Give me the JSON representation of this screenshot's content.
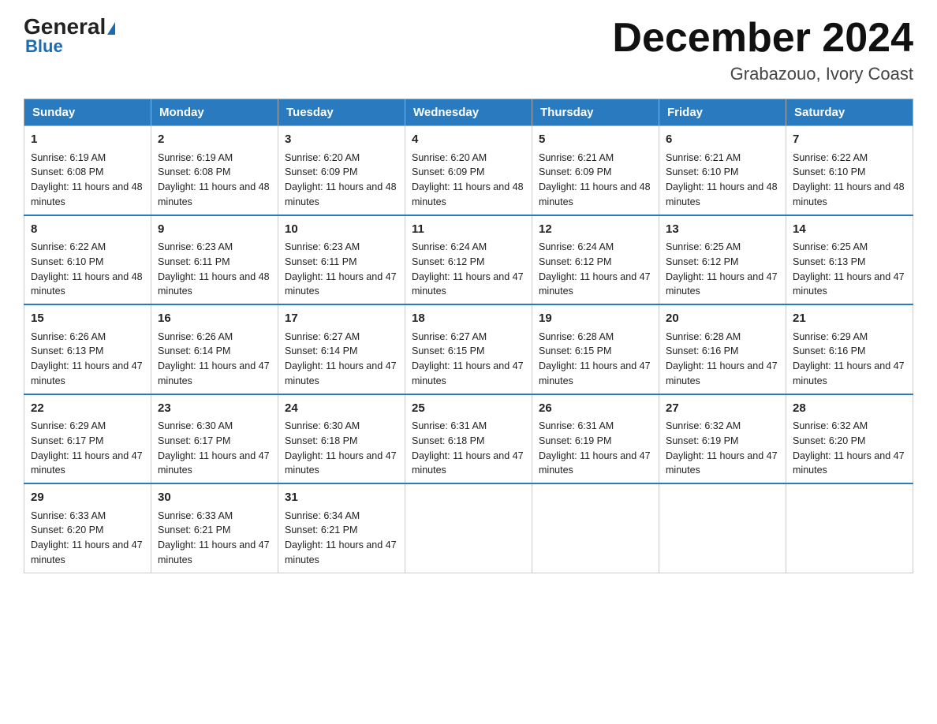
{
  "logo": {
    "brand": "General",
    "sub": "Blue"
  },
  "title": "December 2024",
  "subtitle": "Grabazouo, Ivory Coast",
  "days": [
    "Sunday",
    "Monday",
    "Tuesday",
    "Wednesday",
    "Thursday",
    "Friday",
    "Saturday"
  ],
  "weeks": [
    [
      {
        "num": "1",
        "sunrise": "6:19 AM",
        "sunset": "6:08 PM",
        "daylight": "11 hours and 48 minutes."
      },
      {
        "num": "2",
        "sunrise": "6:19 AM",
        "sunset": "6:08 PM",
        "daylight": "11 hours and 48 minutes."
      },
      {
        "num": "3",
        "sunrise": "6:20 AM",
        "sunset": "6:09 PM",
        "daylight": "11 hours and 48 minutes."
      },
      {
        "num": "4",
        "sunrise": "6:20 AM",
        "sunset": "6:09 PM",
        "daylight": "11 hours and 48 minutes."
      },
      {
        "num": "5",
        "sunrise": "6:21 AM",
        "sunset": "6:09 PM",
        "daylight": "11 hours and 48 minutes."
      },
      {
        "num": "6",
        "sunrise": "6:21 AM",
        "sunset": "6:10 PM",
        "daylight": "11 hours and 48 minutes."
      },
      {
        "num": "7",
        "sunrise": "6:22 AM",
        "sunset": "6:10 PM",
        "daylight": "11 hours and 48 minutes."
      }
    ],
    [
      {
        "num": "8",
        "sunrise": "6:22 AM",
        "sunset": "6:10 PM",
        "daylight": "11 hours and 48 minutes."
      },
      {
        "num": "9",
        "sunrise": "6:23 AM",
        "sunset": "6:11 PM",
        "daylight": "11 hours and 48 minutes."
      },
      {
        "num": "10",
        "sunrise": "6:23 AM",
        "sunset": "6:11 PM",
        "daylight": "11 hours and 47 minutes."
      },
      {
        "num": "11",
        "sunrise": "6:24 AM",
        "sunset": "6:12 PM",
        "daylight": "11 hours and 47 minutes."
      },
      {
        "num": "12",
        "sunrise": "6:24 AM",
        "sunset": "6:12 PM",
        "daylight": "11 hours and 47 minutes."
      },
      {
        "num": "13",
        "sunrise": "6:25 AM",
        "sunset": "6:12 PM",
        "daylight": "11 hours and 47 minutes."
      },
      {
        "num": "14",
        "sunrise": "6:25 AM",
        "sunset": "6:13 PM",
        "daylight": "11 hours and 47 minutes."
      }
    ],
    [
      {
        "num": "15",
        "sunrise": "6:26 AM",
        "sunset": "6:13 PM",
        "daylight": "11 hours and 47 minutes."
      },
      {
        "num": "16",
        "sunrise": "6:26 AM",
        "sunset": "6:14 PM",
        "daylight": "11 hours and 47 minutes."
      },
      {
        "num": "17",
        "sunrise": "6:27 AM",
        "sunset": "6:14 PM",
        "daylight": "11 hours and 47 minutes."
      },
      {
        "num": "18",
        "sunrise": "6:27 AM",
        "sunset": "6:15 PM",
        "daylight": "11 hours and 47 minutes."
      },
      {
        "num": "19",
        "sunrise": "6:28 AM",
        "sunset": "6:15 PM",
        "daylight": "11 hours and 47 minutes."
      },
      {
        "num": "20",
        "sunrise": "6:28 AM",
        "sunset": "6:16 PM",
        "daylight": "11 hours and 47 minutes."
      },
      {
        "num": "21",
        "sunrise": "6:29 AM",
        "sunset": "6:16 PM",
        "daylight": "11 hours and 47 minutes."
      }
    ],
    [
      {
        "num": "22",
        "sunrise": "6:29 AM",
        "sunset": "6:17 PM",
        "daylight": "11 hours and 47 minutes."
      },
      {
        "num": "23",
        "sunrise": "6:30 AM",
        "sunset": "6:17 PM",
        "daylight": "11 hours and 47 minutes."
      },
      {
        "num": "24",
        "sunrise": "6:30 AM",
        "sunset": "6:18 PM",
        "daylight": "11 hours and 47 minutes."
      },
      {
        "num": "25",
        "sunrise": "6:31 AM",
        "sunset": "6:18 PM",
        "daylight": "11 hours and 47 minutes."
      },
      {
        "num": "26",
        "sunrise": "6:31 AM",
        "sunset": "6:19 PM",
        "daylight": "11 hours and 47 minutes."
      },
      {
        "num": "27",
        "sunrise": "6:32 AM",
        "sunset": "6:19 PM",
        "daylight": "11 hours and 47 minutes."
      },
      {
        "num": "28",
        "sunrise": "6:32 AM",
        "sunset": "6:20 PM",
        "daylight": "11 hours and 47 minutes."
      }
    ],
    [
      {
        "num": "29",
        "sunrise": "6:33 AM",
        "sunset": "6:20 PM",
        "daylight": "11 hours and 47 minutes."
      },
      {
        "num": "30",
        "sunrise": "6:33 AM",
        "sunset": "6:21 PM",
        "daylight": "11 hours and 47 minutes."
      },
      {
        "num": "31",
        "sunrise": "6:34 AM",
        "sunset": "6:21 PM",
        "daylight": "11 hours and 47 minutes."
      },
      null,
      null,
      null,
      null
    ]
  ],
  "labels": {
    "sunrise": "Sunrise:",
    "sunset": "Sunset:",
    "daylight": "Daylight:"
  }
}
